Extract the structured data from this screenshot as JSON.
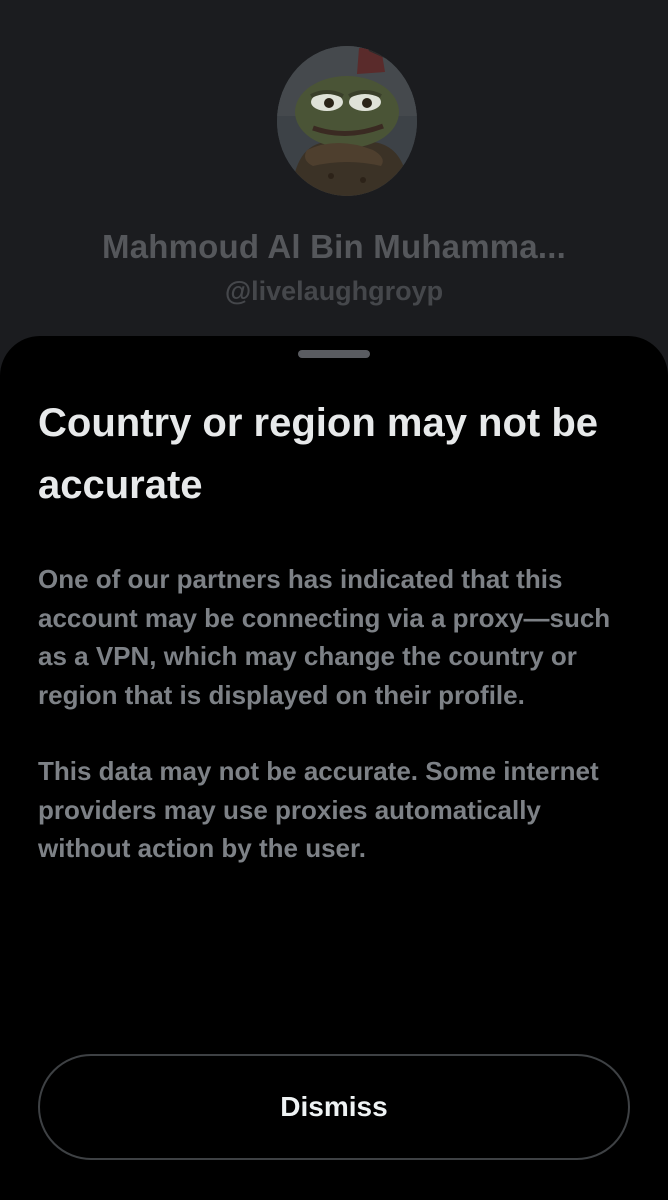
{
  "profile": {
    "display_name": "Mahmoud Al Bin Muhamma...",
    "handle": "@livelaughgroyp",
    "avatar_icon": "frog-avatar"
  },
  "sheet": {
    "title": "Country or region may not be accurate",
    "paragraphs": [
      "One of our partners has indicated that this account may be connecting via a proxy—such as a VPN, which may change the country or region that is displayed on their profile.",
      "This data may not be accurate. Some internet providers may use proxies automatically without action by the user."
    ],
    "dismiss_label": "Dismiss"
  },
  "colors": {
    "sheet_background": "#000000",
    "page_background": "#1b1c1f",
    "title_text": "#e7e9ea",
    "body_text": "#7d8186",
    "button_border": "#3e4144"
  }
}
